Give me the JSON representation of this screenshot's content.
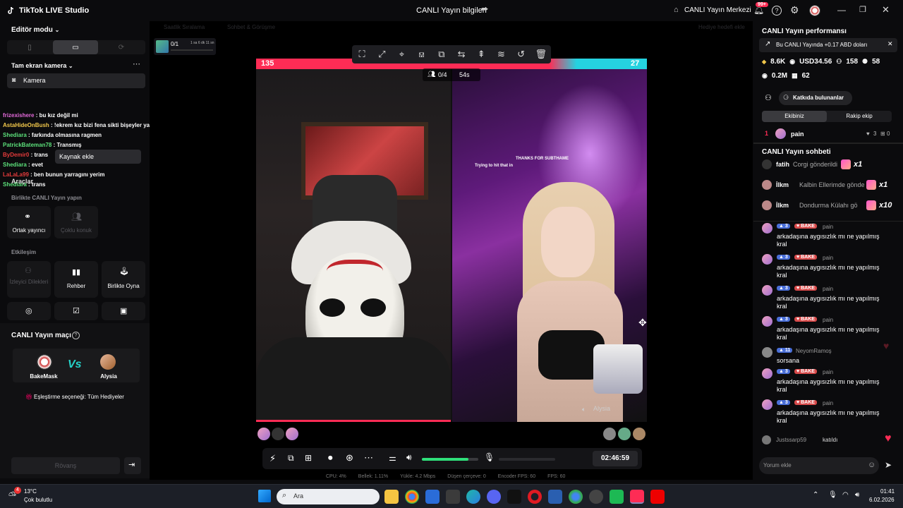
{
  "app": {
    "title": "TikTok LIVE Studio",
    "center_title": "CANLI Yayın bilgileri",
    "center_link": "CANLI Yayın Merkezi",
    "notif_count": "99+"
  },
  "left": {
    "editor_mode": "Editör modu",
    "scene": "Tam ekran kamera",
    "camera": "Kamera",
    "add_source": "Kaynak ekle",
    "tools_title": "Araçlar",
    "together_title": "Birlikte CANLI Yayın yapın",
    "cohost": "Ortak yayıncı",
    "multi_guest": "Çoklu konuk",
    "interaction_title": "Etkileşim",
    "viewer_requests": "İzleyici Dilekleri",
    "guide": "Rehber",
    "play_together": "Birlikte Oyna",
    "match_title": "CANLI Yayın maçı",
    "player1": "BakeMask",
    "player2": "Alysia",
    "match_option": "Eşleştirme seçeneği: Tüm Hediyeler",
    "rematch": "Rövanş"
  },
  "overlay_chat": [
    {
      "user": "frizexishere",
      "text": ": bu kız değil mi",
      "color": "#e36ad9"
    },
    {
      "user": "AstaHideOnBush",
      "text": ": !ekrem kız bizi fena sikti bişeyler yapmamız lazım bu konu hakkında",
      "color": "#f2c84b"
    },
    {
      "user": "Shediara",
      "text": ": farkında olmasına ragmen",
      "color": "#5ce07a"
    },
    {
      "user": "PatrickBateman78",
      "text": ": Transmış",
      "color": "#5ce07a"
    },
    {
      "user": "ByDemir0",
      "text": ": trans",
      "color": "#e33b3b"
    },
    {
      "user": "Shediara",
      "text": ": evet",
      "color": "#5ce07a"
    },
    {
      "user": "LaLaLa99",
      "text": ": ben bunun yarragını yerim",
      "color": "#e33b3b"
    },
    {
      "user": "Shediara",
      "text": ": trans",
      "color": "#5ce07a"
    }
  ],
  "stage": {
    "goal_count": "0/1",
    "goal_time": "1 sa 6 dk 11 sn",
    "tab1": "Saatlik Sıralama",
    "tab2": "Sohbet & Görüşme",
    "tab3": "Hediye hedefi ekle",
    "score_left": "135",
    "score_right": "27",
    "guests": "0/4",
    "timer": "54s",
    "opponent_label": "Alysia",
    "stream_text1": "Trying to hit that in",
    "stream_text2": "THANKS FOR SUBTHAME",
    "duration": "02:46:59",
    "stats": {
      "cpu": "CPU: 4%",
      "mem": "Bellek: 1.11%",
      "upload": "Yükle: 4.2 Mbps",
      "drop": "Düşen çerçeve: 0",
      "enc": "Encoder FPS: 60",
      "fps": "FPS: 60"
    },
    "volume_level": 0.82
  },
  "right": {
    "perf_title": "CANLI Yayın performansı",
    "banner": "Bu CANLI Yayında +0.17 ABD doları",
    "diamonds": "8.6K",
    "usd": "USD34.56",
    "viewers": "158",
    "followers": "58",
    "views": "0.2M",
    "gifters": "62",
    "contributors": "Katkıda bulunanlar",
    "tab_team": "Ekibiniz",
    "tab_rival": "Rakip ekip",
    "rank1_name": "pain",
    "rank1_hearts": "3",
    "rank1_gifts": "0",
    "chat_title": "CANLI Yayın sohbeti",
    "gifts": [
      {
        "user": "fatih",
        "text": "Corgi gönderildi",
        "mult": "x1"
      },
      {
        "user": "İlkm",
        "text": "Kalbin Ellerimde gönde",
        "mult": "x1"
      },
      {
        "user": "İlkm",
        "text": "Dondurma Külahı gö",
        "mult": "x10"
      }
    ],
    "messages": [
      {
        "user": "pain",
        "level": "3",
        "team": "BAKE",
        "text": "arkadaşına aygısızlık mı ne yapılmış kral"
      },
      {
        "user": "pain",
        "level": "3",
        "team": "BAKE",
        "text": "arkadaşına aygısızlık mı ne yapılmış kral"
      },
      {
        "user": "pain",
        "level": "3",
        "team": "BAKE",
        "text": "arkadaşına aygısızlık mı ne yapılmış kral"
      },
      {
        "user": "pain",
        "level": "3",
        "team": "BAKE",
        "text": "arkadaşına aygısızlık mı ne yapılmış kral"
      },
      {
        "user": "NeyomRamoş",
        "level": "11",
        "team": "",
        "text": "sorsana"
      },
      {
        "user": "pain",
        "level": "3",
        "team": "BAKE",
        "text": "arkadaşına aygısızlık mı ne yapılmış kral"
      },
      {
        "user": "pain",
        "level": "3",
        "team": "BAKE",
        "text": "arkadaşına aygısızlık mı ne yapılmış kral"
      }
    ],
    "joined_user": "Justssarp59",
    "joined_text": "katıldı",
    "comment_placeholder": "Yorum ekle"
  },
  "taskbar": {
    "temp": "13°C",
    "weather": "Çok bulutlu",
    "search": "Ara",
    "time": "01:41",
    "date": "6.02.2026",
    "weather_badge": "4"
  }
}
